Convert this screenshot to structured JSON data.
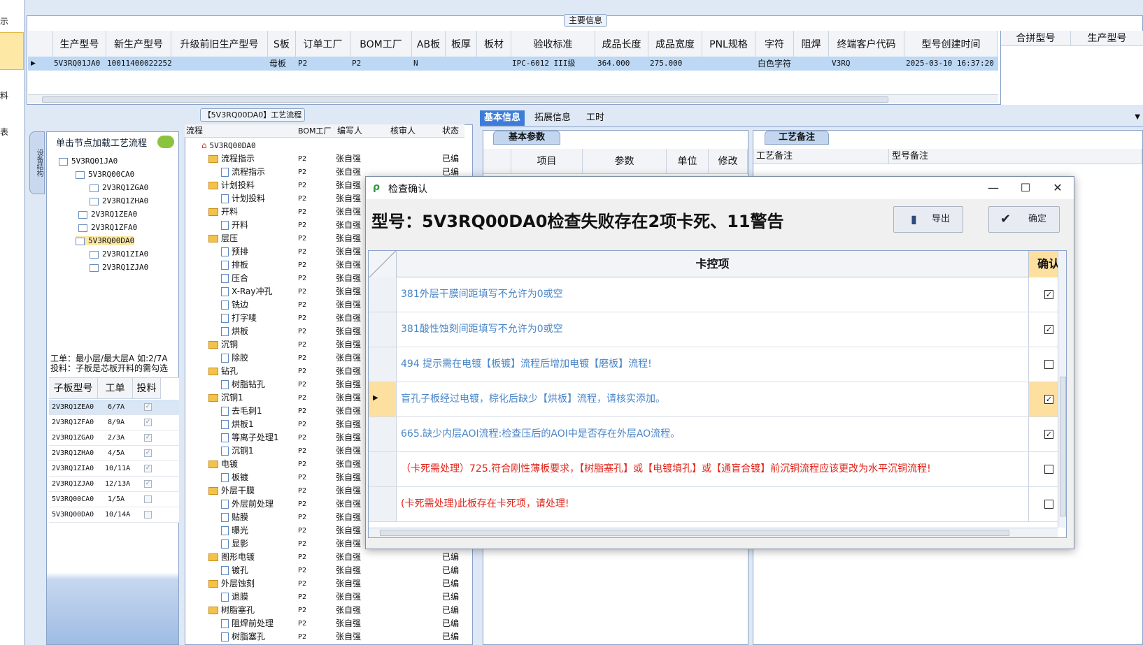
{
  "left_strip": {
    "labels": [
      "示",
      "料",
      "表"
    ]
  },
  "main_info": {
    "legend": "主要信息",
    "columns": [
      "生产型号",
      "新生产型号",
      "升级前旧生产型号",
      "S板",
      "订单工厂",
      "BOM工厂",
      "AB板",
      "板厚",
      "板材",
      "验收标准",
      "成品长度",
      "成品宽度",
      "PNL规格",
      "字符",
      "阻焊",
      "终端客户代码",
      "型号创建时间"
    ],
    "row": {
      "prod_model": "5V3RQ01JA0",
      "new_model": "10011400022252",
      "s_board": "母板",
      "order_factory": "P2",
      "bom_factory": "P2",
      "ab_board": "N",
      "standard": "IPC-6012 III级",
      "length": "364.000",
      "width": "275.000",
      "char": "白色字符",
      "customer_code": "V3RQ",
      "created": "2025-03-10 16:37:20"
    },
    "merge_columns": [
      "合拼型号",
      "生产型号"
    ]
  },
  "left_panel": {
    "vertical_tab": "设备结构",
    "load_hint": "单击节点加载工艺流程",
    "tree": [
      "5V3RQ01JA0",
      "5V3RQ00CA0",
      "2V3RQ1ZGA0",
      "2V3RQ1ZHA0",
      "2V3RQ1ZEA0",
      "2V3RQ1ZFA0",
      "5V3RQ00DA0",
      "2V3RQ1ZIA0",
      "2V3RQ1ZJA0"
    ],
    "note_line1": "工单：最小层/最大层A 如:2/7A",
    "note_line2": "投料：子板是芯板开料的需勾选",
    "sub_columns": [
      "子板型号",
      "工单",
      "投料"
    ],
    "sub_rows": [
      {
        "model": "2V3RQ1ZEA0",
        "order": "6/7A",
        "check": "✓"
      },
      {
        "model": "2V3RQ1ZFA0",
        "order": "8/9A",
        "check": "✓"
      },
      {
        "model": "2V3RQ1ZGA0",
        "order": "2/3A",
        "check": "✓"
      },
      {
        "model": "2V3RQ1ZHA0",
        "order": "4/5A",
        "check": "✓"
      },
      {
        "model": "2V3RQ1ZIA0",
        "order": "10/11A",
        "check": "✓"
      },
      {
        "model": "2V3RQ1ZJA0",
        "order": "12/13A",
        "check": "✓"
      },
      {
        "model": "5V3RQ00CA0",
        "order": "1/5A",
        "check": ""
      },
      {
        "model": "5V3RQ00DA0",
        "order": "10/14A",
        "check": ""
      }
    ]
  },
  "flow": {
    "title": "【5V3RQ00DA0】工艺流程",
    "columns": [
      "流程",
      "BOM工厂",
      "编写人",
      "核审人",
      "状态"
    ],
    "root": "5V3RQ00DA0",
    "rows": [
      {
        "name": "流程指示",
        "folder": true,
        "bom": "P2",
        "writer": "张自强",
        "status": "已编"
      },
      {
        "name": "流程指示",
        "folder": false,
        "bom": "P2",
        "writer": "张自强",
        "status": "已编"
      },
      {
        "name": "计划投料",
        "folder": true,
        "bom": "P2",
        "writer": "张自强",
        "status": ""
      },
      {
        "name": "计划投料",
        "folder": false,
        "bom": "P2",
        "writer": "张自强",
        "status": ""
      },
      {
        "name": "开料",
        "folder": true,
        "bom": "P2",
        "writer": "张自强",
        "status": ""
      },
      {
        "name": "开料",
        "folder": false,
        "bom": "P2",
        "writer": "张自强",
        "status": ""
      },
      {
        "name": "层压",
        "folder": true,
        "bom": "P2",
        "writer": "张自强",
        "status": ""
      },
      {
        "name": "预排",
        "folder": false,
        "bom": "P2",
        "writer": "张自强",
        "status": ""
      },
      {
        "name": "排板",
        "folder": false,
        "bom": "P2",
        "writer": "张自强",
        "status": ""
      },
      {
        "name": "压合",
        "folder": false,
        "bom": "P2",
        "writer": "张自强",
        "status": ""
      },
      {
        "name": "X-Ray冲孔",
        "folder": false,
        "bom": "P2",
        "writer": "张自强",
        "status": ""
      },
      {
        "name": "铣边",
        "folder": false,
        "bom": "P2",
        "writer": "张自强",
        "status": ""
      },
      {
        "name": "打字唛",
        "folder": false,
        "bom": "P2",
        "writer": "张自强",
        "status": ""
      },
      {
        "name": "烘板",
        "folder": false,
        "bom": "P2",
        "writer": "张自强",
        "status": ""
      },
      {
        "name": "沉铜",
        "folder": true,
        "bom": "P2",
        "writer": "张自强",
        "status": ""
      },
      {
        "name": "除胶",
        "folder": false,
        "bom": "P2",
        "writer": "张自强",
        "status": ""
      },
      {
        "name": "钻孔",
        "folder": true,
        "bom": "P2",
        "writer": "张自强",
        "status": ""
      },
      {
        "name": "树脂钻孔",
        "folder": false,
        "bom": "P2",
        "writer": "张自强",
        "status": ""
      },
      {
        "name": "沉铜1",
        "folder": true,
        "bom": "P2",
        "writer": "张自强",
        "status": ""
      },
      {
        "name": "去毛刺1",
        "folder": false,
        "bom": "P2",
        "writer": "张自强",
        "status": ""
      },
      {
        "name": "烘板1",
        "folder": false,
        "bom": "P2",
        "writer": "张自强",
        "status": ""
      },
      {
        "name": "等离子处理1",
        "folder": false,
        "bom": "P2",
        "writer": "张自强",
        "status": ""
      },
      {
        "name": "沉铜1",
        "folder": false,
        "bom": "P2",
        "writer": "张自强",
        "status": ""
      },
      {
        "name": "电镀",
        "folder": true,
        "bom": "P2",
        "writer": "张自强",
        "status": ""
      },
      {
        "name": "板镀",
        "folder": false,
        "bom": "P2",
        "writer": "张自强",
        "status": ""
      },
      {
        "name": "外层干膜",
        "folder": true,
        "bom": "P2",
        "writer": "张自强",
        "status": ""
      },
      {
        "name": "外层前处理",
        "folder": false,
        "bom": "P2",
        "writer": "张自强",
        "status": ""
      },
      {
        "name": "贴膜",
        "folder": false,
        "bom": "P2",
        "writer": "张自强",
        "status": ""
      },
      {
        "name": "曝光",
        "folder": false,
        "bom": "P2",
        "writer": "张自强",
        "status": ""
      },
      {
        "name": "显影",
        "folder": false,
        "bom": "P2",
        "writer": "张自强",
        "status": ""
      },
      {
        "name": "图形电镀",
        "folder": true,
        "bom": "P2",
        "writer": "张自强",
        "status": "已编"
      },
      {
        "name": "镀孔",
        "folder": false,
        "bom": "P2",
        "writer": "张自强",
        "status": "已编"
      },
      {
        "name": "外层蚀刻",
        "folder": true,
        "bom": "P2",
        "writer": "张自强",
        "status": "已编"
      },
      {
        "name": "退膜",
        "folder": false,
        "bom": "P2",
        "writer": "张自强",
        "status": "已编"
      },
      {
        "name": "树脂塞孔",
        "folder": true,
        "bom": "P2",
        "writer": "张自强",
        "status": "已编"
      },
      {
        "name": "阻焊前处理",
        "folder": false,
        "bom": "P2",
        "writer": "张自强",
        "status": "已编"
      },
      {
        "name": "树脂塞孔",
        "folder": false,
        "bom": "P2",
        "writer": "张自强",
        "status": "已编"
      }
    ]
  },
  "right_tabs": [
    "基本信息",
    "拓展信息",
    "工时"
  ],
  "basic_params": {
    "tab": "基本参数",
    "columns": [
      "项目",
      "参数",
      "单位",
      "修改"
    ]
  },
  "process_notes": {
    "tab": "工艺备注",
    "columns": [
      "工艺备注",
      "型号备注"
    ]
  },
  "dialog": {
    "title": "检查确认",
    "message": "型号：5V3RQ00DA0检查失败存在2项卡死、11警告",
    "export_label": "导出",
    "confirm_label": "确定",
    "col_item": "卡控项",
    "col_confirm": "确认",
    "rows": [
      {
        "text": "381外层干膜间距填写不允许为0或空",
        "color": "blue",
        "checked": "✓",
        "selected": false
      },
      {
        "text": "381酸性蚀刻间距填写不允许为0或空",
        "color": "blue",
        "checked": "✓",
        "selected": false
      },
      {
        "text": "494 提示需在电镀【板镀】流程后增加电镀【磨板】流程!",
        "color": "blue",
        "checked": "",
        "selected": false
      },
      {
        "text": "盲孔子板经过电镀，棕化后缺少【烘板】流程，请核实添加。",
        "color": "blue",
        "checked": "✓",
        "selected": true
      },
      {
        "text": "665.缺少内层AOI流程:检查压后的AOI中是否存在外层AO流程。",
        "color": "blue",
        "checked": "✓",
        "selected": false
      },
      {
        "text": "（卡死需处理）725.符合刚性薄板要求，【树脂塞孔】或【电镀填孔】或【通盲合镀】前沉铜流程应该更改为水平沉铜流程!",
        "color": "red",
        "checked": "",
        "selected": false
      },
      {
        "text": "(卡死需处理)此板存在卡死项，请处理!",
        "color": "red",
        "checked": "",
        "selected": false
      }
    ]
  },
  "colors": {
    "accent": "#3d7dd8",
    "selected_row": "#bcd8f4",
    "warn_text": "#4a86c8",
    "error_text": "#e0241a",
    "highlight": "#fde0a0"
  }
}
